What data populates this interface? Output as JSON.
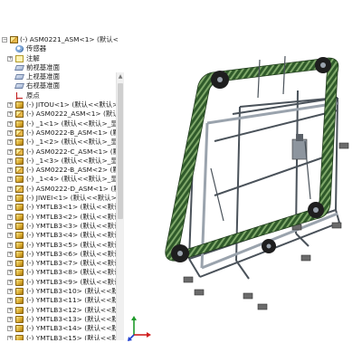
{
  "feature_tree": {
    "root": {
      "label": "(-) ASM0221_ASM<1> (默认<默"
    },
    "items": [
      {
        "label": "传感器",
        "icon": "sensor-icon",
        "indent": 1,
        "expander": "none"
      },
      {
        "label": "注解",
        "icon": "note-icon",
        "indent": 1,
        "expander": "plus"
      },
      {
        "label": "前视基准面",
        "icon": "plane-icon",
        "indent": 1,
        "expander": "none"
      },
      {
        "label": "上视基准面",
        "icon": "plane-icon",
        "indent": 1,
        "expander": "none"
      },
      {
        "label": "右视基准面",
        "icon": "plane-icon",
        "indent": 1,
        "expander": "none"
      },
      {
        "label": "原点",
        "icon": "origin-icon",
        "indent": 1,
        "expander": "none"
      },
      {
        "label": "(-) JITOU<1> (默认<<默认>_显",
        "icon": "part-icon",
        "indent": 1,
        "expander": "plus"
      },
      {
        "label": "(-) ASM0222_ASM<1> (默认<",
        "icon": "assembly-icon",
        "indent": 1,
        "expander": "plus"
      },
      {
        "label": "(-) _1<1> (默认<<默认>_显示状",
        "icon": "part-icon",
        "indent": 1,
        "expander": "plus"
      },
      {
        "label": "(-) ASM0222-B_ASM<1> (默",
        "icon": "assembly-icon",
        "indent": 1,
        "expander": "plus"
      },
      {
        "label": "(-) _1<2> (默认<<默认>_显示状",
        "icon": "part-icon",
        "indent": 1,
        "expander": "plus"
      },
      {
        "label": "(-) ASM0222-C_ASM<1> (默",
        "icon": "assembly-icon",
        "indent": 1,
        "expander": "plus"
      },
      {
        "label": "(-) _1<3> (默认<<默认>_显示状",
        "icon": "part-icon",
        "indent": 1,
        "expander": "plus"
      },
      {
        "label": "(-) ASM0222-B_ASM<2> (默",
        "icon": "assembly-icon",
        "indent": 1,
        "expander": "plus"
      },
      {
        "label": "(-) _1<4> (默认<<默认>_显示状",
        "icon": "part-icon",
        "indent": 1,
        "expander": "plus"
      },
      {
        "label": "(-) ASM0222-D_ASM<1> (默",
        "icon": "assembly-icon",
        "indent": 1,
        "expander": "plus"
      },
      {
        "label": "(-) JIWEI<1> (默认<<默认>_显",
        "icon": "part-icon",
        "indent": 1,
        "expander": "plus"
      },
      {
        "label": "(-) YMTLB3<1> (默认<<默认>",
        "icon": "part-icon",
        "indent": 1,
        "expander": "plus"
      },
      {
        "label": "(-) YMTLB3<2> (默认<<默认>",
        "icon": "part-icon",
        "indent": 1,
        "expander": "plus"
      },
      {
        "label": "(-) YMTLB3<3> (默认<<默认>",
        "icon": "part-icon",
        "indent": 1,
        "expander": "plus"
      },
      {
        "label": "(-) YMTLB3<4> (默认<<默认>",
        "icon": "part-icon",
        "indent": 1,
        "expander": "plus"
      },
      {
        "label": "(-) YMTLB3<5> (默认<<默认>",
        "icon": "part-icon",
        "indent": 1,
        "expander": "plus"
      },
      {
        "label": "(-) YMTLB3<6> (默认<<默认>",
        "icon": "part-icon",
        "indent": 1,
        "expander": "plus"
      },
      {
        "label": "(-) YMTLB3<7> (默认<<默认>",
        "icon": "part-icon",
        "indent": 1,
        "expander": "plus"
      },
      {
        "label": "(-) YMTLB3<8> (默认<<默认>",
        "icon": "part-icon",
        "indent": 1,
        "expander": "plus"
      },
      {
        "label": "(-) YMTLB3<9> (默认<<默认>",
        "icon": "part-icon",
        "indent": 1,
        "expander": "plus"
      },
      {
        "label": "(-) YMTLB3<10> (默认<<默认",
        "icon": "part-icon",
        "indent": 1,
        "expander": "plus"
      },
      {
        "label": "(-) YMTLB3<11> (默认<<默认",
        "icon": "part-icon",
        "indent": 1,
        "expander": "plus"
      },
      {
        "label": "(-) YMTLB3<12> (默认<<默认",
        "icon": "part-icon",
        "indent": 1,
        "expander": "plus"
      },
      {
        "label": "(-) YMTLB3<13> (默认<<默认",
        "icon": "part-icon",
        "indent": 1,
        "expander": "plus"
      },
      {
        "label": "(-) YMTLB3<14> (默认<<默认",
        "icon": "part-icon",
        "indent": 1,
        "expander": "plus"
      },
      {
        "label": "(-) YMTLB3<15> (默认<<默认",
        "icon": "part-icon",
        "indent": 1,
        "expander": "plus"
      }
    ]
  },
  "colors": {
    "frame_steel": "#9aa3ad",
    "frame_dark": "#4a525a",
    "chain_green": "#2f5a2a",
    "chain_highlight": "#7fa86a",
    "gear_dark": "#1e1e1e",
    "foot_pad": "#6b6b6b",
    "triad_red": "#d02020",
    "triad_green": "#1f9a2a",
    "triad_blue": "#2040d0"
  }
}
